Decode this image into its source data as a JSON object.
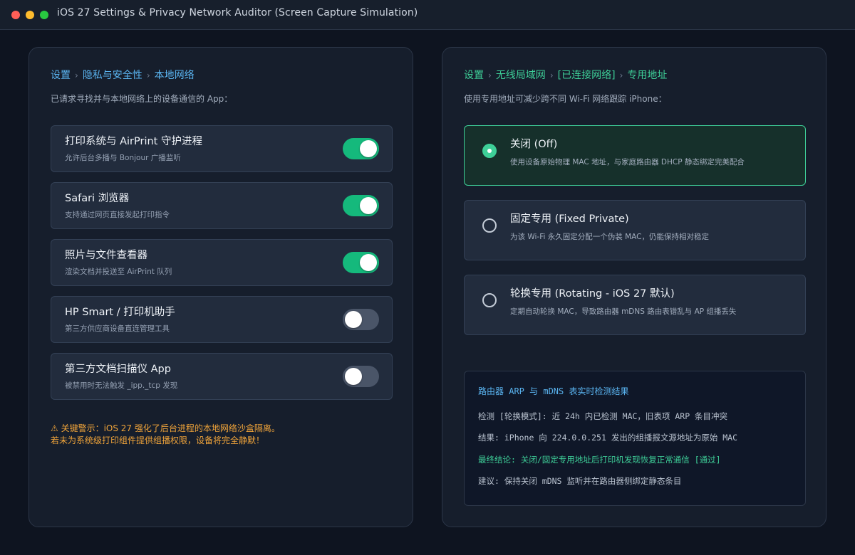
{
  "window": {
    "title": "iOS 27 Settings & Privacy Network Auditor (Screen Capture Simulation)"
  },
  "left": {
    "breadcrumb": [
      "设置",
      "隐私与安全性",
      "本地网络"
    ],
    "subtitle": "已请求寻找并与本地网络上的设备通信的 App：",
    "rows": [
      {
        "title": "打印系统与 AirPrint 守护进程",
        "desc": "允许后台多播与 Bonjour 广播监听",
        "on": true
      },
      {
        "title": "Safari 浏览器",
        "desc": "支持通过网页直接发起打印指令",
        "on": true
      },
      {
        "title": "照片与文件查看器",
        "desc": "渲染文档并投送至 AirPrint 队列",
        "on": true
      },
      {
        "title": "HP Smart / 打印机助手",
        "desc": "第三方供应商设备直连管理工具",
        "on": false
      },
      {
        "title": "第三方文档扫描仪 App",
        "desc": "被禁用时无法触发 _ipp._tcp 发现",
        "on": false
      }
    ],
    "warning_line1": "⚠ 关键警示：iOS 27 强化了后台进程的本地网络沙盒隔离。",
    "warning_line2": "若未为系统级打印组件提供组播权限，设备将完全静默！",
    "colors": {
      "accent": "#5ab4f0",
      "switch_on": "#15b97c",
      "switch_off": "#4a5568",
      "warning": "#f0a43a"
    }
  },
  "right": {
    "breadcrumb": [
      "设置",
      "无线局域网",
      "[已连接网络]",
      "专用地址"
    ],
    "subtitle": "使用专用地址可减少跨不同 Wi-Fi 网络跟踪 iPhone：",
    "options": [
      {
        "title": "关闭 (Off)",
        "desc": "使用设备原始物理 MAC 地址，与家庭路由器 DHCP 静态绑定完美配合",
        "selected": true
      },
      {
        "title": "固定专用 (Fixed Private)",
        "desc": "为该 Wi-Fi 永久固定分配一个伪装 MAC，仍能保持相对稳定",
        "selected": false
      },
      {
        "title": "轮换专用 (Rotating - iOS 27 默认)",
        "desc": "定期自动轮换 MAC，导致路由器 mDNS 路由表错乱与 AP 组播丢失",
        "selected": false
      }
    ],
    "log": {
      "title": "路由器 ARP 与 mDNS 表实时检测结果",
      "lines": [
        {
          "text": "检测 [轮换模式]: 近 24h 内已检测 MAC，旧表项 ARP 条目冲突",
          "ok": false
        },
        {
          "text": "结果: iPhone 向 224.0.0.251 发出的组播报文源地址为原始 MAC",
          "ok": false
        },
        {
          "text": "最终结论: 关闭/固定专用地址后打印机发现恢复正常通信 [通过]",
          "ok": true
        },
        {
          "text": "建议: 保持关闭 mDNS 监听并在路由器侧绑定静态条目",
          "ok": false
        }
      ]
    },
    "colors": {
      "accent": "#3ecf98",
      "selected_bg": "#16302b"
    }
  }
}
